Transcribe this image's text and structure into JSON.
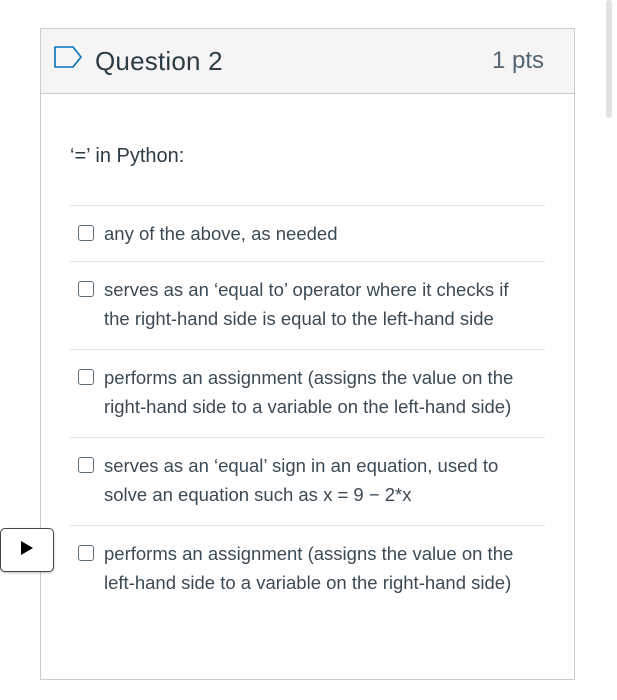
{
  "question": {
    "title": "Question 2",
    "points": "1 pts",
    "text": "‘=’ in Python:",
    "flag_icon": "flag-outline-icon"
  },
  "answers": [
    {
      "label": "any of the above, as needed",
      "checked": false
    },
    {
      "label": "serves as an ‘equal to’ operator where it checks if the right-hand side is equal to the left-hand side",
      "checked": false
    },
    {
      "label": "performs an assignment (assigns the value on the right-hand side to a variable on the left-hand side)",
      "checked": false
    },
    {
      "label": "serves as an ‘equal’ sign in an equation, used to solve an equation such as x = 9 − 2*x",
      "checked": false
    },
    {
      "label": "performs an assignment (assigns the value on the left-hand side to a variable on the right-hand side)",
      "checked": false
    }
  ],
  "play_button": {
    "icon": "play-icon"
  },
  "colors": {
    "header_bg": "#f5f5f5",
    "border": "#c7cdd1",
    "text": "#2d3b45",
    "accent": "#0374b5"
  }
}
